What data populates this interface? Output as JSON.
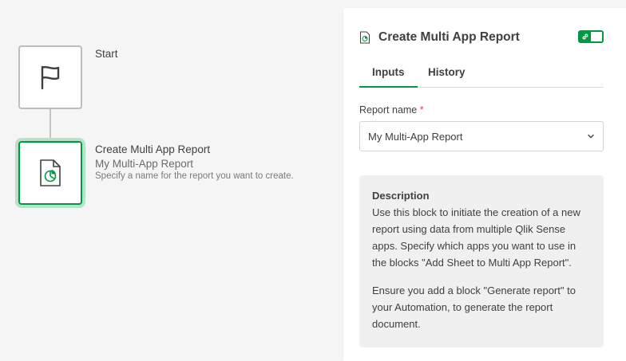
{
  "canvas": {
    "start_node": {
      "label": "Start",
      "icon": "flag-icon"
    },
    "report_node": {
      "title": "Create Multi App Report",
      "subtitle": "My Multi-App Report",
      "description": "Specify a name for the report you want to create.",
      "icon": "report-document-icon"
    }
  },
  "panel": {
    "title": "Create Multi App Report",
    "title_icon": "report-document-icon",
    "toggle_state": "on",
    "tabs": [
      {
        "label": "Inputs",
        "active": true
      },
      {
        "label": "History",
        "active": false
      }
    ],
    "field": {
      "label": "Report name",
      "required_marker": "*",
      "value": "My Multi-App Report"
    },
    "description": {
      "heading": "Description",
      "paragraph1": "Use this block to initiate the creation of a new report using data from multiple Qlik Sense apps. Specify which apps you want to use in the blocks \"Add Sheet to Multi App Report\".",
      "paragraph2": "Ensure you add a block \"Generate report\" to your Automation, to generate the report document."
    }
  },
  "colors": {
    "accent": "#009845",
    "selection_halo": "#b8e2c8",
    "required": "#dc423f"
  }
}
